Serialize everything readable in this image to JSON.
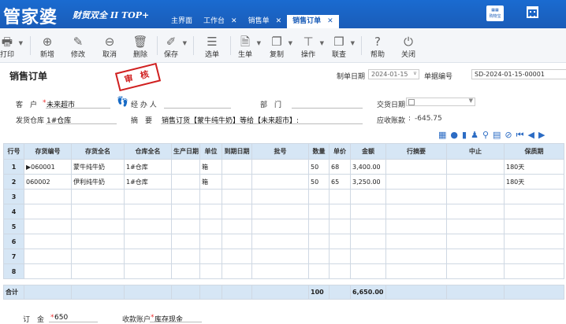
{
  "app": {
    "logo": "管家婆",
    "logo_sub": "财贸双全 II TOP+"
  },
  "tabs": [
    {
      "label": "主界面",
      "closable": false,
      "active": false
    },
    {
      "label": "工作台",
      "closable": true,
      "active": false
    },
    {
      "label": "销售单",
      "closable": true,
      "active": false
    },
    {
      "label": "销售订单",
      "closable": true,
      "active": true
    }
  ],
  "tab_close": "✕",
  "topright": {
    "notice_label": "购物宝"
  },
  "toolbar": {
    "print": "打印",
    "add": "新增",
    "edit": "修改",
    "cancel": "取消",
    "delete": "删除",
    "save": "保存",
    "select": "选单",
    "gen": "生单",
    "copy": "复制",
    "ops": "操作",
    "query": "联查",
    "help": "帮助",
    "close": "关闭"
  },
  "header": {
    "title": "销售订单",
    "stamp": "审 核",
    "date_label": "制单日期",
    "date_value": "2024-01-15",
    "billno_label": "单据编号",
    "billno_value": "SD-2024-01-15-00001",
    "customer_label": "客　户",
    "customer_value": "未来超市",
    "handler_label": "经 办 人",
    "dept_label": "部　门",
    "deal_date_label": "交货日期",
    "warehouse_label": "发货仓库",
    "warehouse_value": "1#仓库",
    "summary_label": "摘　要",
    "summary_value": "销售订货【蒙牛纯牛奶】等给【未来超市】:",
    "receivable_label": "应收账款",
    "receivable_value": "-645.75"
  },
  "table": {
    "columns": [
      "行号",
      "存货编号",
      "存货全名",
      "仓库全名",
      "生产日期",
      "单位",
      "到期日期",
      "批号",
      "数量",
      "单价",
      "金额",
      "行摘要",
      "中止",
      "保质期"
    ],
    "rows": [
      {
        "idx": "1",
        "code": "060001",
        "name": "蒙牛纯牛奶",
        "wh": "1#仓库",
        "unit": "箱",
        "qty": "50",
        "price": "68",
        "amount": "3,400.00",
        "shelf": "180天"
      },
      {
        "idx": "2",
        "code": "060002",
        "name": "伊利纯牛奶",
        "wh": "1#仓库",
        "unit": "箱",
        "qty": "50",
        "price": "65",
        "amount": "3,250.00",
        "shelf": "180天"
      },
      {
        "idx": "3"
      },
      {
        "idx": "4"
      },
      {
        "idx": "5"
      },
      {
        "idx": "6"
      },
      {
        "idx": "7"
      },
      {
        "idx": "8"
      }
    ],
    "total_label": "合计",
    "total_qty": "100",
    "total_amount": "6,650.00"
  },
  "footer": {
    "deposit_label": "订　金",
    "deposit_value": "650",
    "account_label": "收款账户",
    "account_value": "库存现金"
  }
}
